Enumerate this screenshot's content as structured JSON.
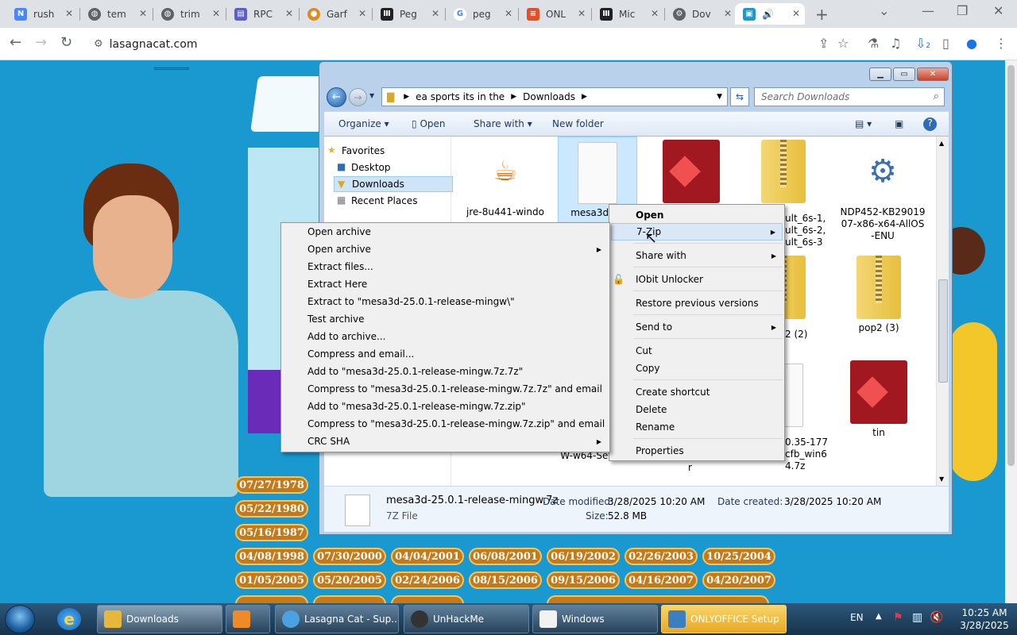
{
  "browser": {
    "tabs": [
      {
        "label": "rush",
        "icon": "nordvpn-icon",
        "color": "#4687ff"
      },
      {
        "label": "tem",
        "icon": "globe-icon",
        "color": "#5f6368"
      },
      {
        "label": "trim",
        "icon": "globe-icon",
        "color": "#5f6368"
      },
      {
        "label": "RPC",
        "icon": "document-icon",
        "color": "#5b5fc7"
      },
      {
        "label": "Garf",
        "icon": "garfield-icon",
        "color": "#e08a1e"
      },
      {
        "label": "Peg",
        "icon": "museum-icon",
        "color": "#202124"
      },
      {
        "label": "peg",
        "icon": "google-icon",
        "color": "#4285f4"
      },
      {
        "label": "ONL",
        "icon": "onlyoffice-icon",
        "color": "#e34f26"
      },
      {
        "label": "Mic",
        "icon": "museum-icon",
        "color": "#202124"
      },
      {
        "label": "Dov",
        "icon": "gear-icon",
        "color": "#5f6368"
      },
      {
        "label": "",
        "icon": "lasagna-icon",
        "color": "#1a98d0"
      }
    ],
    "url": "lasagnacat.com",
    "download_count": "2"
  },
  "explorer": {
    "breadcrumb": [
      "ea sports its in the",
      "Downloads"
    ],
    "search_placeholder": "Search Downloads",
    "commands": {
      "organize": "Organize",
      "open": "Open",
      "share_with": "Share with",
      "new_folder": "New folder"
    },
    "nav": {
      "favorites": "Favorites",
      "items": [
        "Desktop",
        "Downloads",
        "Recent Places"
      ]
    },
    "files": [
      {
        "name": "jre-8u441-windo",
        "type": "java"
      },
      {
        "name": "mesa3d-25",
        "type": "blank",
        "selected": true
      },
      {
        "name": "",
        "type": "red"
      },
      {
        "name": "ult_6s-1,\nult_6s-2,\nult_6s-3",
        "type": "zip"
      },
      {
        "name": "NDP452-KB29019\n07-x86-x64-AllOS\n-ENU",
        "type": "setup"
      },
      {
        "name": "2 (2)",
        "type": "zip"
      },
      {
        "name": "pop2 (3)",
        "type": "zip"
      },
      {
        "name": "Windows-\nW-w64-Setup-9.2",
        "type": "hidden"
      },
      {
        "name": "r",
        "type": "hidden"
      },
      {
        "name": "0.35-177\ncfb_win6\n4.7z",
        "type": "blank"
      },
      {
        "name": "tin",
        "type": "red"
      }
    ],
    "details": {
      "filename": "mesa3d-25.0.1-release-mingw.7z",
      "filetype": "7Z File",
      "modified_label": "Date modified:",
      "modified": "3/28/2025 10:20 AM",
      "created_label": "Date created:",
      "created": "3/28/2025 10:20 AM",
      "size_label": "Size:",
      "size": "52.8 MB"
    }
  },
  "context_menu": {
    "items": [
      "Open",
      "7-Zip",
      "Share with",
      "IObit Unlocker",
      "Restore previous versions",
      "Send to",
      "Cut",
      "Copy",
      "Create shortcut",
      "Delete",
      "Rename",
      "Properties"
    ]
  },
  "zip_menu": {
    "items": [
      "Open archive",
      "Open archive",
      "Extract files...",
      "Extract Here",
      "Extract to \"mesa3d-25.0.1-release-mingw\\\"",
      "Test archive",
      "Add to archive...",
      "Compress and email...",
      "Add to \"mesa3d-25.0.1-release-mingw.7z.7z\"",
      "Compress to \"mesa3d-25.0.1-release-mingw.7z.7z\" and email",
      "Add to \"mesa3d-25.0.1-release-mingw.7z.zip\"",
      "Compress to \"mesa3d-25.0.1-release-mingw.7z.zip\" and email",
      "CRC SHA"
    ]
  },
  "page": {
    "dates": [
      [
        "07/27/1978",
        "",
        "",
        "",
        "",
        "",
        ""
      ],
      [
        "05/22/1980",
        "",
        "",
        "",
        "",
        "",
        ""
      ],
      [
        "05/16/1987",
        "",
        "",
        "",
        "",
        "",
        ""
      ],
      [
        "04/08/1998",
        "07/30/2000",
        "04/04/2001",
        "06/08/2001",
        "06/19/2002",
        "02/26/2003",
        "10/25/2004"
      ],
      [
        "01/05/2005",
        "05/20/2005",
        "02/24/2006",
        "08/15/2006",
        "09/15/2006",
        "04/16/2007",
        "04/20/2007"
      ]
    ]
  },
  "taskbar": {
    "buttons": [
      {
        "label": "Downloads",
        "state": "active"
      },
      {
        "label": ""
      },
      {
        "label": "Lasagna Cat - Sup..."
      },
      {
        "label": "UnHackMe"
      },
      {
        "label": "Windows"
      },
      {
        "label": "ONLYOFFICE Setup",
        "state": "flash"
      }
    ],
    "lang": "EN",
    "time": "10:25 AM",
    "date": "3/28/2025"
  }
}
